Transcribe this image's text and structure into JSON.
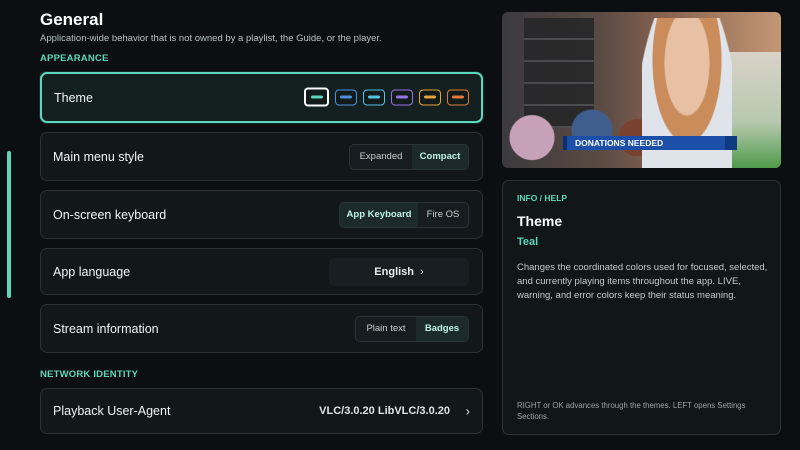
{
  "header": {
    "title": "General",
    "subtitle": "Application-wide behavior that is not owned by a playlist, the Guide, or the player."
  },
  "sections": {
    "appearance": "APPEARANCE",
    "network_identity": "NETWORK IDENTITY"
  },
  "settings": {
    "theme": {
      "label": "Theme",
      "selected": "Teal",
      "swatches": [
        {
          "name": "teal",
          "color": "#5ed6bb",
          "selected": true
        },
        {
          "name": "blue",
          "color": "#4f8fe0"
        },
        {
          "name": "cyan",
          "color": "#53c2e6"
        },
        {
          "name": "purple",
          "color": "#9a72e8"
        },
        {
          "name": "amber",
          "color": "#e7a23a"
        },
        {
          "name": "orange",
          "color": "#e37a3c"
        }
      ]
    },
    "main_menu_style": {
      "label": "Main menu style",
      "options": [
        "Expanded",
        "Compact"
      ],
      "selected": "Compact"
    },
    "onscreen_keyboard": {
      "label": "On-screen keyboard",
      "options": [
        "App Keyboard",
        "Fire OS"
      ],
      "selected": "App Keyboard"
    },
    "app_language": {
      "label": "App language",
      "value": "English",
      "chevron": "›"
    },
    "stream_information": {
      "label": "Stream information",
      "options": [
        "Plain text",
        "Badges"
      ],
      "selected": "Badges"
    },
    "playback_user_agent": {
      "label": "Playback User-Agent",
      "value": "VLC/3.0.20 LibVLC/3.0.20",
      "chevron": "›"
    }
  },
  "video": {
    "chyron": "DONATIONS NEEDED"
  },
  "help": {
    "kicker": "INFO / HELP",
    "title": "Theme",
    "value": "Teal",
    "description": "Changes the coordinated colors used for focused, selected, and currently playing items throughout the app. LIVE, warning, and error colors keep their status meaning.",
    "footer": "RIGHT or OK advances through the themes. LEFT opens Settings Sections."
  },
  "colors": {
    "accent": "#5ed6bb",
    "background": "#0b0f11",
    "row_background": "#121719"
  }
}
